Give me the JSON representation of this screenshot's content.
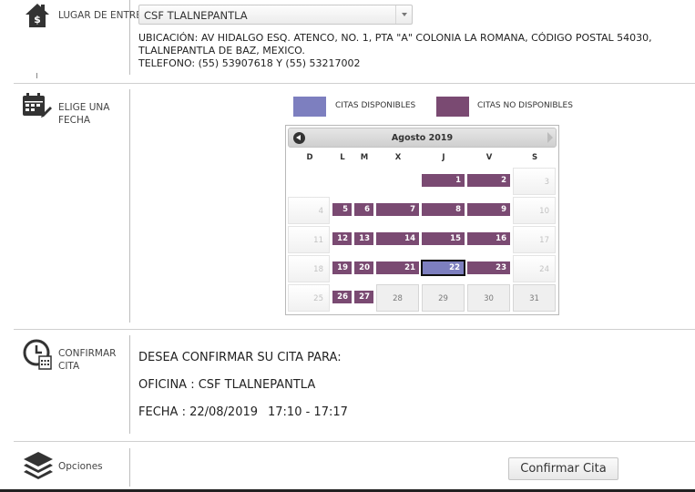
{
  "delivery": {
    "label": "LUGAR DE ENTREGA",
    "select_value": "CSF TLALNEPANTLA",
    "address_lines": [
      "UBICACIÓN: AV HIDALGO ESQ. ATENCO, NO. 1, PTA \"A\" COLONIA LA ROMANA, CÓDIGO POSTAL 54030,",
      "TLALNEPANTLA DE BAZ, MEXICO.",
      "TELEFONO: (55) 53907618 Y (55) 53217002"
    ]
  },
  "date_section": {
    "label": "ELIGE UNA FECHA",
    "legend": {
      "available_label": "CITAS DISPONIBLES",
      "unavailable_label": "CITAS NO DISPONIBLES",
      "available_color": "#7d7fbf",
      "unavailable_color": "#7a4a72"
    },
    "calendar": {
      "month_title": "Agosto 2019",
      "weekdays": [
        "D",
        "L",
        "M",
        "X",
        "J",
        "V",
        "S"
      ],
      "selected_day": "22",
      "days": [
        "1",
        "2",
        "3",
        "4",
        "5",
        "6",
        "7",
        "8",
        "9",
        "10",
        "11",
        "12",
        "13",
        "14",
        "15",
        "16",
        "17",
        "18",
        "19",
        "20",
        "21",
        "22",
        "23",
        "24",
        "25",
        "26",
        "27",
        "28",
        "29",
        "30",
        "31"
      ]
    }
  },
  "confirm": {
    "label": "CONFIRMAR CITA",
    "question": "DESEA CONFIRMAR SU CITA PARA:",
    "office": "OFICINA : CSF TLALNEPANTLA",
    "date": "FECHA : 22/08/2019",
    "time": "17:10 - 17:17"
  },
  "options": {
    "label": "Opciones",
    "confirm_button": "Confirmar Cita"
  }
}
